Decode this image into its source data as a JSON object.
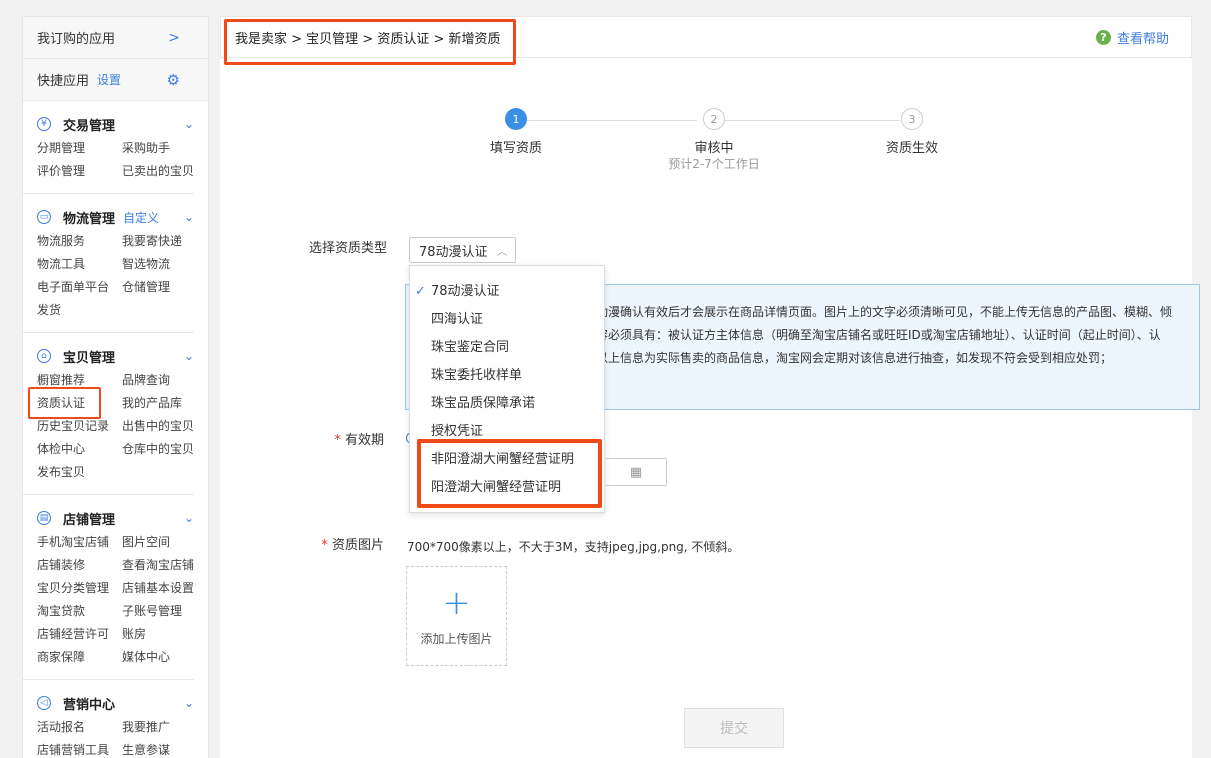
{
  "sidebar": {
    "subscribed_apps": "我订购的应用",
    "subscribed_arrow": ">",
    "quick_apps": "快捷应用",
    "quick_settings": "设置",
    "sections": [
      {
        "title": "交易管理",
        "icon": "yen-icon",
        "items": [
          "分期管理",
          "采购助手",
          "评价管理",
          "已卖出的宝贝"
        ]
      },
      {
        "title": "物流管理",
        "icon": "truck-icon",
        "custom": "自定义",
        "items": [
          "物流服务",
          "我要寄快递",
          "物流工具",
          "智选物流",
          "电子面单平台",
          "仓储管理",
          "发货"
        ]
      },
      {
        "title": "宝贝管理",
        "icon": "bag-icon",
        "items": [
          "橱窗推荐",
          "品牌查询",
          "资质认证",
          "我的产品库",
          "历史宝贝记录",
          "出售中的宝贝",
          "体检中心",
          "仓库中的宝贝",
          "发布宝贝"
        ]
      },
      {
        "title": "店铺管理",
        "icon": "shop-icon",
        "items": [
          "手机淘宝店铺",
          "图片空间",
          "店铺装修",
          "查看淘宝店铺",
          "宝贝分类管理",
          "店铺基本设置",
          "淘宝贷款",
          "子账号管理",
          "店铺经营许可",
          "账房",
          "商家保障",
          "媒体中心"
        ]
      },
      {
        "title": "营销中心",
        "icon": "megaphone-icon",
        "items": [
          "活动报名",
          "我要推广",
          "店铺营销工具",
          "生意参谋"
        ]
      }
    ]
  },
  "header": {
    "breadcrumb": "我是卖家 > 宝贝管理 > 资质认证 > 新增资质",
    "help": "查看帮助"
  },
  "steps": [
    {
      "num": "1",
      "label": "填写资质",
      "sub": ""
    },
    {
      "num": "2",
      "label": "审核中",
      "sub": "预计2-7个工作日"
    },
    {
      "num": "3",
      "label": "资质生效",
      "sub": ""
    }
  ],
  "form": {
    "type_label": "选择资质类型",
    "type_value": "78动漫认证",
    "notice_lines": [
      "动漫确认有效后才会展示在商品详情页面。图片上的文字必须清晰可见，不能上传无信息的产品图、模糊、倾",
      "容必须具有：被认证方主体信息（明确至淘宝店铺名或旺旺ID或淘宝店铺地址）、认证时间（起止时间）、认",
      "以上信息为实际售卖的商品信息，淘宝网会定期对该信息进行抽查，如发现不符会受到相应处罚；"
    ],
    "validity_label": "有效期",
    "image_label": "资质图片",
    "required_mark": "*",
    "image_tip": "700*700像素以上，不大于3M，支持jpeg,jpg,png, 不倾斜。",
    "upload_plus": "+",
    "upload_text": "添加上传图片",
    "submit": "提交"
  },
  "dropdown": {
    "options": [
      "78动漫认证",
      "四海认证",
      "珠宝鉴定合同",
      "珠宝委托收样单",
      "珠宝品质保障承诺",
      "授权凭证",
      "非阳澄湖大闸蟹经营证明",
      "阳澄湖大闸蟹经营证明"
    ],
    "selected": "78动漫认证",
    "check": "✓"
  },
  "colors": {
    "accent": "#3a7de0",
    "highlight": "#f04a1a",
    "notice_bg": "#eef6fd"
  }
}
